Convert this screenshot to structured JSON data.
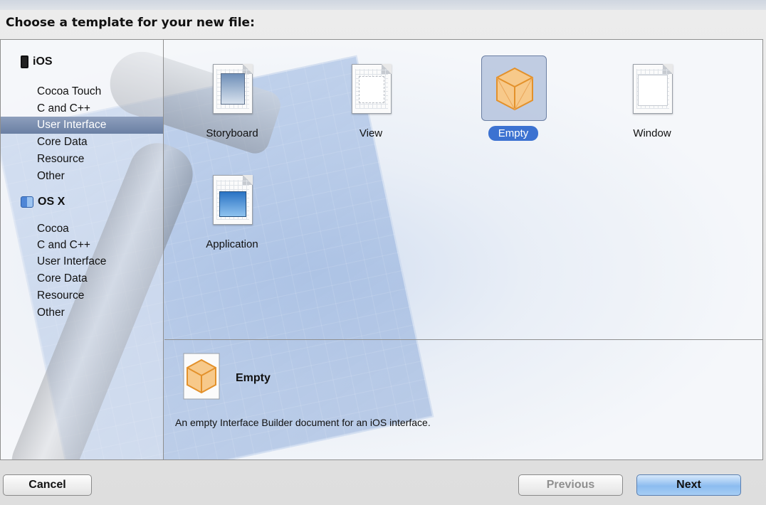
{
  "dialog": {
    "title": "Choose a template for your new file:"
  },
  "sidebar": {
    "groups": [
      {
        "name": "iOS",
        "icon": "iphone-icon",
        "items": [
          "Cocoa Touch",
          "C and C++",
          "User Interface",
          "Core Data",
          "Resource",
          "Other"
        ]
      },
      {
        "name": "OS X",
        "icon": "finder-icon",
        "items": [
          "Cocoa",
          "C and C++",
          "User Interface",
          "Core Data",
          "Resource",
          "Other"
        ]
      }
    ],
    "selected_group": "iOS",
    "selected_item": "User Interface"
  },
  "templates": [
    {
      "label": "Storyboard",
      "icon": "storyboard-document-icon"
    },
    {
      "label": "View",
      "icon": "view-document-icon"
    },
    {
      "label": "Empty",
      "icon": "empty-cube-icon",
      "selected": true
    },
    {
      "label": "Window",
      "icon": "window-document-icon"
    },
    {
      "label": "Application",
      "icon": "application-document-icon"
    }
  ],
  "description": {
    "name": "Empty",
    "text": "An empty Interface Builder document for an iOS interface."
  },
  "buttons": {
    "cancel": "Cancel",
    "previous": "Previous",
    "next": "Next"
  },
  "colors": {
    "selection_blue": "#3c72d1",
    "sidebar_selection": "#7b8db0",
    "primary_button": "#8cbcf0"
  }
}
